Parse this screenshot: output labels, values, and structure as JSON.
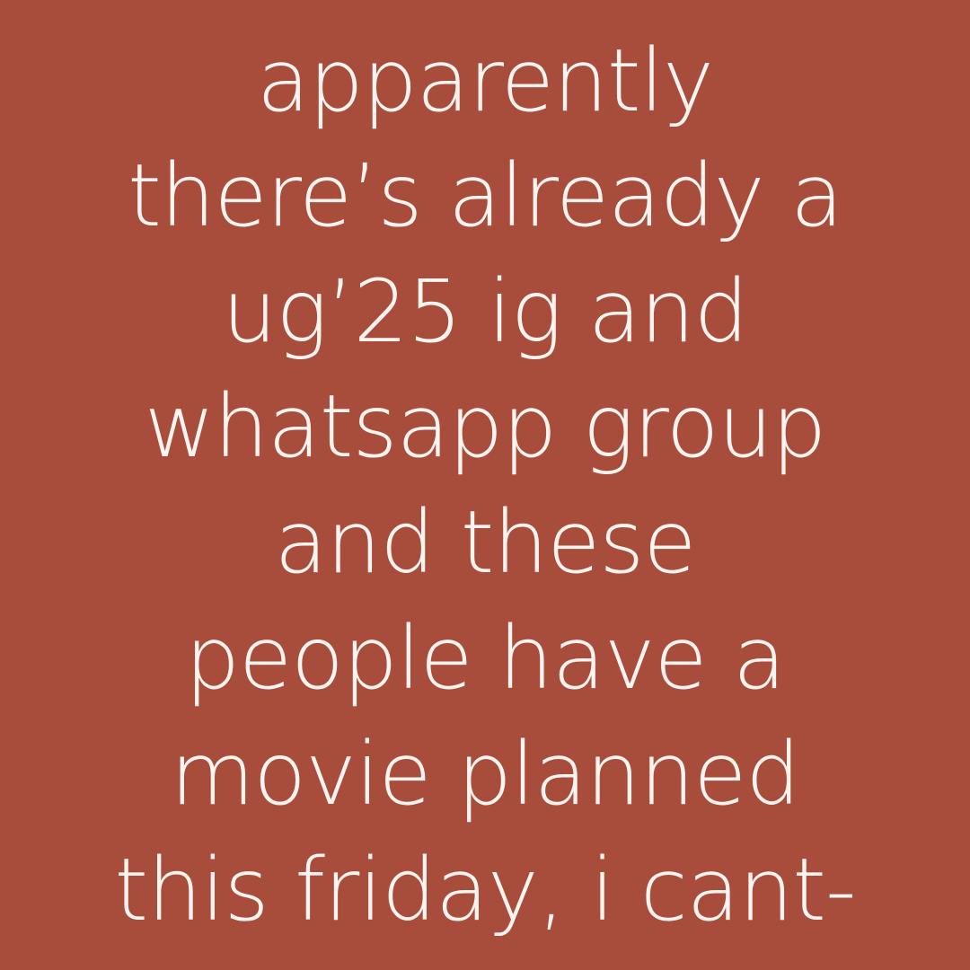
{
  "post": {
    "background_color": "#a84c3c",
    "text_color": "#fdf3ef",
    "lines": [
      "apparently",
      "there’s already a",
      "ug’25 ig and",
      "whatsapp group",
      "and these",
      "people have a",
      "movie planned",
      "this friday, i cant-"
    ]
  }
}
